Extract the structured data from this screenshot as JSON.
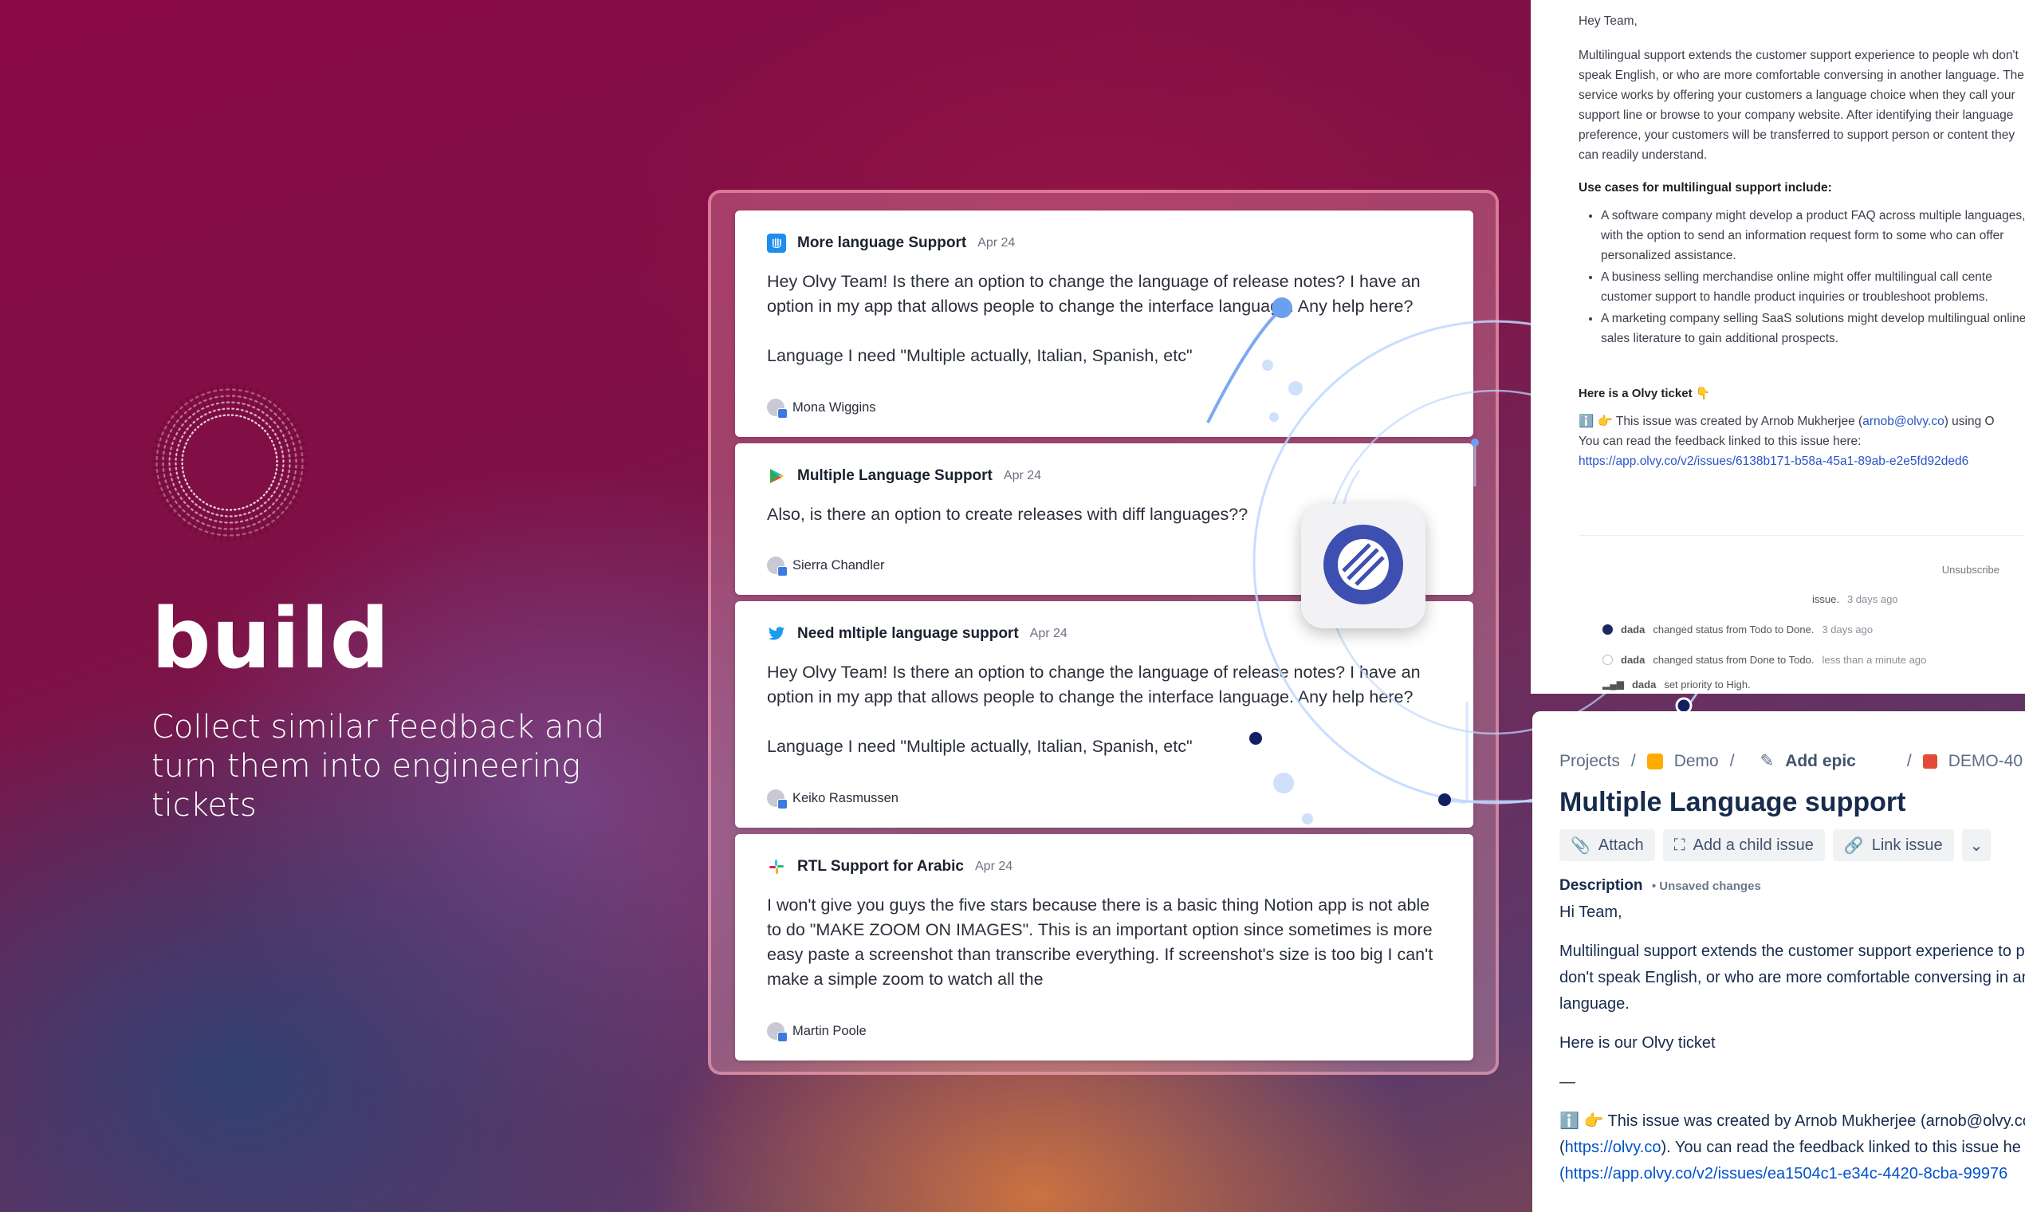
{
  "hero": {
    "title": "build",
    "subtitle": "Collect similar feedback and turn them into engineering tickets"
  },
  "feedback_cards": [
    {
      "source_icon": "intercom-icon",
      "title": "More language Support",
      "date": "Apr 24",
      "body": "Hey Olvy Team! Is there an option to change the language of release notes? I have an option in my app that allows people to change the interface language. Any help here?\n\nLanguage I need \"Multiple actually, Italian, Spanish, etc\"",
      "author": "Mona Wiggins"
    },
    {
      "source_icon": "google-play-icon",
      "title": "Multiple Language Support",
      "date": "Apr 24",
      "body": "Also, is there an option to create releases with diff languages??",
      "author": "Sierra Chandler"
    },
    {
      "source_icon": "twitter-icon",
      "title": "Need mltiple language support",
      "date": "Apr 24",
      "body": "Hey Olvy Team! Is there an option to change the language of release notes? I have an option in my app that allows people to change the interface language. Any help here?\n\nLanguage I need \"Multiple actually, Italian, Spanish, etc\"",
      "author": "Keiko Rasmussen"
    },
    {
      "source_icon": "slack-icon",
      "title": "RTL Support for Arabic",
      "date": "Apr 24",
      "body": "I won't give you guys the five stars because there is a basic thing Notion app is not able to do \"MAKE ZOOM ON IMAGES\". This is an important option since sometimes is more easy paste a screenshot than transcribe everything. If screenshot's size is too big I can't make a simple zoom to watch all the",
      "author": "Martin Poole"
    }
  ],
  "integrations": {
    "linear_icon": "linear-logo-icon",
    "jira_icon": "jira-logo-icon"
  },
  "doc": {
    "greeting": "Hey Team,",
    "intro": "Multilingual support extends the customer support experience to people wh don't speak English, or who are more comfortable conversing in another language. The service works by offering your customers a language choice when they call your support line or browse to your company website. After identifying their language preference, your customers will be transferred to support person or content they can readily understand.",
    "use_cases_heading": "Use cases for multilingual support include:",
    "use_cases": [
      "A software company might develop a product FAQ across multiple languages, with the option to send an information request form to some who can offer personalized assistance.",
      "A business selling merchandise online might offer multilingual call cente customer support to handle product inquiries or troubleshoot problems.",
      "A marketing company selling SaaS solutions might develop multilingual online sales literature to gain additional prospects."
    ],
    "ticket_heading": "Here is a Olvy ticket 👇",
    "ticket_line_prefix": "ℹ️ 👉 This issue was created by Arnob Mukherjee (",
    "ticket_email": "arnob@olvy.co",
    "ticket_line_suffix": ") using O",
    "ticket_line2": "You can read the feedback linked to this issue here:",
    "ticket_link": "https://app.olvy.co/v2/issues/6138b171-b58a-45a1-89ab-e2e5fd92ded6",
    "unsubscribe": "Unsubscribe",
    "activity": [
      {
        "actor": "",
        "text": "issue.",
        "time": "3 days ago"
      },
      {
        "actor": "dada",
        "text": "changed status from Todo to Done.",
        "time": "3 days ago"
      },
      {
        "actor": "dada",
        "text": "changed status from Done to Todo.",
        "time": "less than a minute ago"
      },
      {
        "actor": "dada",
        "text": "set priority to High.",
        "time": ""
      }
    ]
  },
  "jira": {
    "breadcrumb": [
      "Projects",
      "Demo",
      "Add epic",
      "DEMO-40"
    ],
    "title": "Multiple Language support",
    "buttons": [
      "Attach",
      "Add a child issue",
      "Link issue"
    ],
    "description_label": "Description",
    "unsaved": "• Unsaved changes",
    "lines": [
      "Hi Team,",
      "Multilingual support extends the customer support experience to p",
      "don't speak English, or who are more comfortable conversing in an",
      "language.",
      "Here is our Olvy ticket",
      "—",
      "ℹ️ 👉 This issue was created by Arnob Mukherjee (arnob@olvy.co",
      "). You can read the feedback linked to this issue he",
      "(https://app.olvy.co/v2/issues/ea1504c1-e34c-4420-8cba-99976"
    ],
    "link1": "https://olvy.co",
    "colors": {
      "link": "#0052cc",
      "text": "#172b4d"
    }
  }
}
